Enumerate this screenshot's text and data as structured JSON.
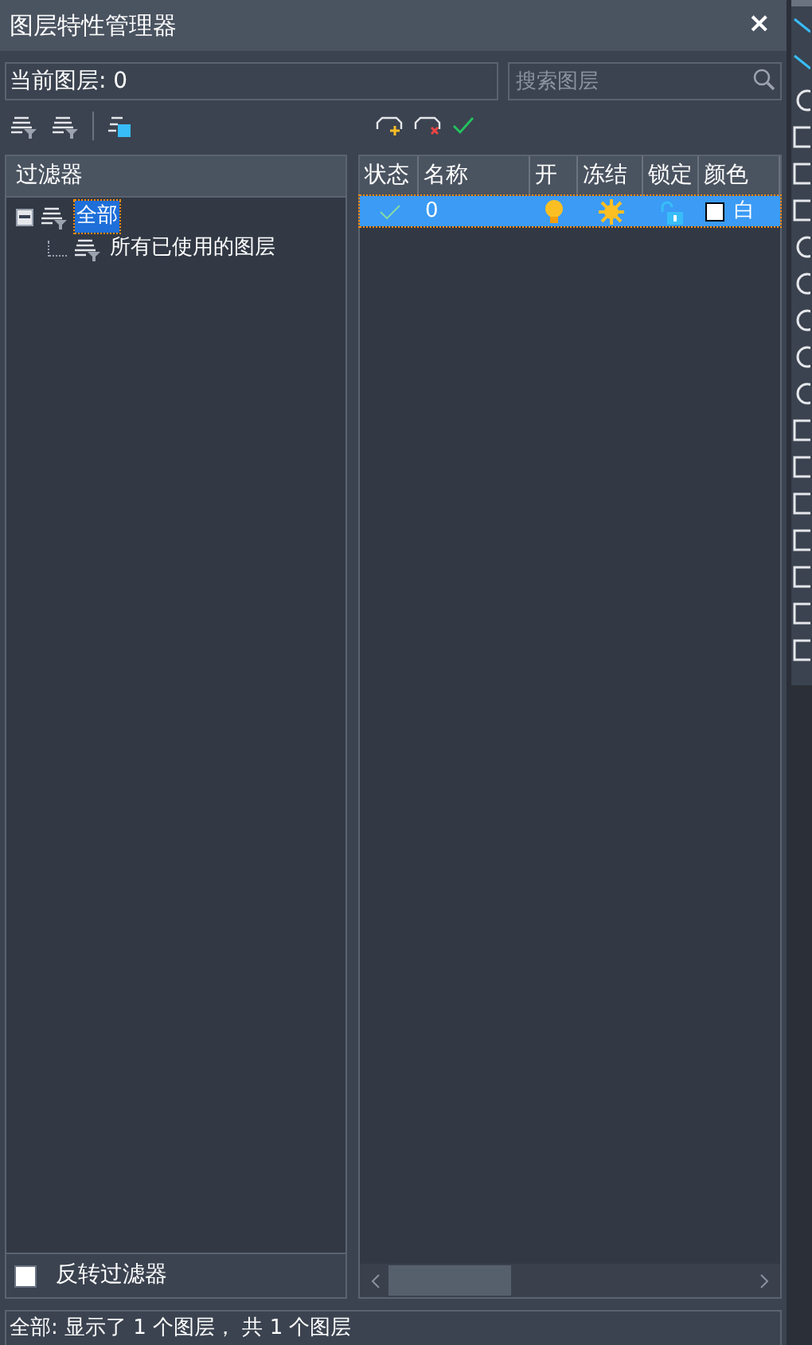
{
  "window": {
    "title": "图层特性管理器",
    "close": "×"
  },
  "current_layer": "当前图层: 0",
  "search": {
    "placeholder": "搜索图层"
  },
  "filters": {
    "header": "过滤器",
    "tree": [
      {
        "label": "全部",
        "selected": true,
        "expanded": true,
        "children": [
          {
            "label": "所有已使用的图层",
            "selected": false
          }
        ]
      }
    ]
  },
  "invert_filter": {
    "label": "反转过滤器",
    "checked": false
  },
  "table": {
    "columns": [
      "状态",
      "名称",
      "开",
      "冻结",
      "锁定",
      "颜色"
    ],
    "rows": [
      {
        "current": true,
        "name": "0",
        "on": true,
        "frozen": false,
        "locked": false,
        "color": "#ffffff",
        "color_name": "白",
        "selected": true
      }
    ]
  },
  "status_bar": "全部: 显示了 1 个图层， 共 1 个图层"
}
